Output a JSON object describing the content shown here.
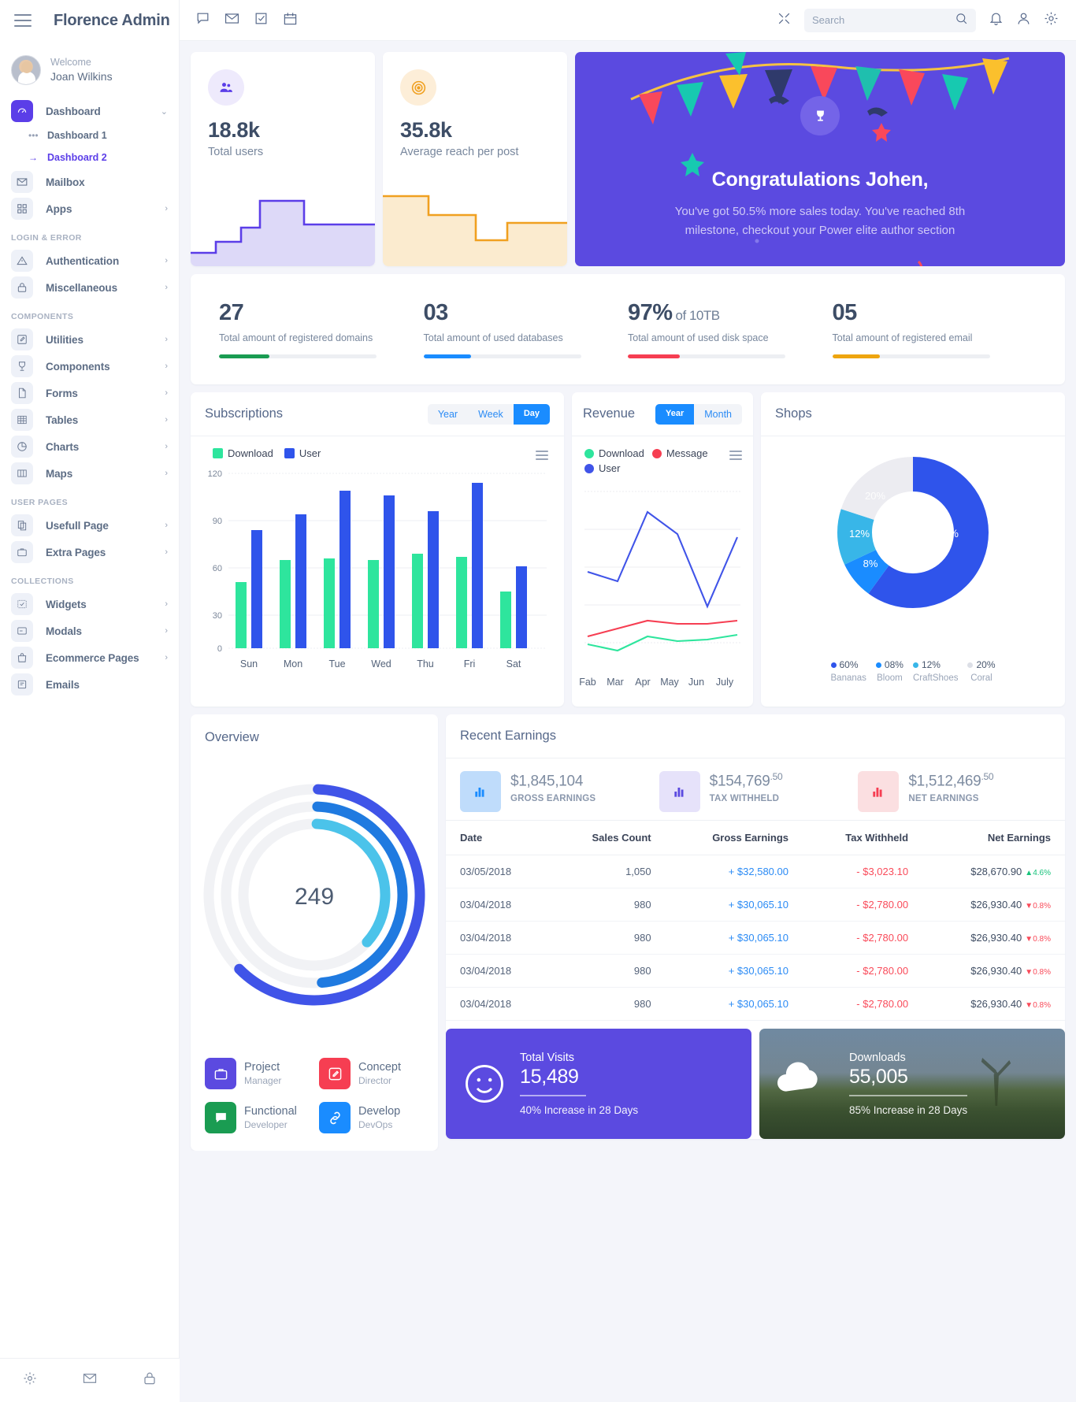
{
  "brand": {
    "name": "Florence Admin"
  },
  "user": {
    "welcome": "Welcome",
    "name": "Joan Wilkins"
  },
  "sidebar": {
    "items": [
      {
        "label": "Dashboard",
        "icon": "dashboard-icon",
        "chevron": "⌄"
      },
      {
        "label": "Mailbox",
        "icon": "mail-icon",
        "chevron": ""
      },
      {
        "label": "Apps",
        "icon": "apps-icon",
        "chevron": "›"
      }
    ],
    "sub": [
      {
        "label": "Dashboard 1",
        "marker": "•••"
      },
      {
        "label": "Dashboard 2",
        "marker": "→"
      }
    ],
    "sections": [
      {
        "title": "LOGIN & ERROR",
        "items": [
          {
            "label": "Authentication",
            "icon": "warning-icon",
            "chevron": "›"
          },
          {
            "label": "Miscellaneous",
            "icon": "lock-icon",
            "chevron": "›"
          }
        ]
      },
      {
        "title": "COMPONENTS",
        "items": [
          {
            "label": "Utilities",
            "icon": "pencil-icon",
            "chevron": "›"
          },
          {
            "label": "Components",
            "icon": "trophy-icon",
            "chevron": "›"
          },
          {
            "label": "Forms",
            "icon": "file-icon",
            "chevron": "›"
          },
          {
            "label": "Tables",
            "icon": "table-icon",
            "chevron": "›"
          },
          {
            "label": "Charts",
            "icon": "piechart-icon",
            "chevron": "›"
          },
          {
            "label": "Maps",
            "icon": "map-icon",
            "chevron": "›"
          }
        ]
      },
      {
        "title": "USER PAGES",
        "items": [
          {
            "label": "Usefull Page",
            "icon": "copy-icon",
            "chevron": "›"
          },
          {
            "label": "Extra Pages",
            "icon": "briefcase-icon",
            "chevron": "›"
          }
        ]
      },
      {
        "title": "COLLECTIONS",
        "items": [
          {
            "label": "Widgets",
            "icon": "widget-icon",
            "chevron": "›"
          },
          {
            "label": "Modals",
            "icon": "modal-icon",
            "chevron": "›"
          },
          {
            "label": "Ecommerce Pages",
            "icon": "bag-icon",
            "chevron": "›"
          },
          {
            "label": "Emails",
            "icon": "email-icon",
            "chevron": ""
          }
        ]
      }
    ]
  },
  "topbar": {
    "icons": [
      "chat-icon",
      "mail-icon",
      "task-icon",
      "calendar-icon"
    ],
    "expand_icon": "expand-icon",
    "search": {
      "placeholder": "Search",
      "value": "",
      "icon": "search-icon"
    },
    "bell_icon": "bell-icon",
    "user_icon": "user-icon",
    "gear_icon": "gear-icon"
  },
  "stat_cards": [
    {
      "value": "18.8k",
      "label": "Total users",
      "icon": "users-icon",
      "color": "#5b3ee8"
    },
    {
      "value": "35.8k",
      "label": "Average reach per post",
      "icon": "target-icon",
      "color": "#f0a020"
    }
  ],
  "welcome_card": {
    "title": "Congratulations Johen,",
    "body": "You've got 50.5% more sales today. You've reached 8th milestone, checkout your Power elite author section",
    "icon": "trophy-icon",
    "bg": "#5b4ae0"
  },
  "mini_stats": [
    {
      "value": "27",
      "suffix": "",
      "label": "Total amount of registered domains",
      "color": "#1a9c52",
      "pct": 32
    },
    {
      "value": "03",
      "suffix": "",
      "label": "Total amount of used databases",
      "color": "#1a8cff",
      "pct": 30
    },
    {
      "value": "97%",
      "suffix": "of 10TB",
      "label": "Total amount of used disk space",
      "color": "#f63e52",
      "pct": 33
    },
    {
      "value": "05",
      "suffix": "",
      "label": "Total amount of registered email",
      "color": "#eea50f",
      "pct": 30
    }
  ],
  "subscriptions": {
    "title": "Subscriptions",
    "toggle": [
      {
        "label": "Year",
        "active": false
      },
      {
        "label": "Week",
        "active": false
      },
      {
        "label": "Day",
        "active": true
      }
    ],
    "menu_icon": "menu-icon"
  },
  "revenue": {
    "title": "Revenue",
    "toggle": [
      {
        "label": "Year",
        "active": true
      },
      {
        "label": "Month",
        "active": false
      }
    ],
    "menu_icon": "menu-icon"
  },
  "shops": {
    "title": "Shops"
  },
  "overview": {
    "title": "Overview",
    "center_value": "249"
  },
  "team": [
    {
      "name": "Project",
      "role": "Manager",
      "icon": "briefcase-icon",
      "color": "#5b4ae0"
    },
    {
      "name": "Concept",
      "role": "Director",
      "icon": "edit-icon",
      "color": "#f63e52"
    },
    {
      "name": "Functional",
      "role": "Developer",
      "icon": "chat-icon",
      "color": "#1a9c52"
    },
    {
      "name": "Develop",
      "role": "DevOps",
      "icon": "link-icon",
      "color": "#1a8cff"
    }
  ],
  "earnings": {
    "title": "Recent Earnings",
    "summary": [
      {
        "amount": "$1,845,104",
        "cents": "",
        "label": "GROSS EARNINGS",
        "icon": "bars-icon",
        "bg": "#bfdcfb",
        "bar": "#1a8cff"
      },
      {
        "amount": "$154,769",
        "cents": ".50",
        "label": "TAX WITHHELD",
        "icon": "bars-icon",
        "bg": "#e6e2fa",
        "bar": "#5b4ae0"
      },
      {
        "amount": "$1,512,469",
        "cents": ".50",
        "label": "NET EARNINGS",
        "icon": "bars-icon",
        "bg": "#fbdfe1",
        "bar": "#f63e52"
      }
    ],
    "columns": [
      "Date",
      "Sales Count",
      "Gross Earnings",
      "Tax Withheld",
      "Net Earnings"
    ],
    "rows": [
      {
        "date": "03/05/2018",
        "count": "1,050",
        "gross": "+ $32,580.00",
        "tax": "- $3,023.10",
        "net": "$28,670.90",
        "pct": "4.6%",
        "dir": "up"
      },
      {
        "date": "03/04/2018",
        "count": "980",
        "gross": "+ $30,065.10",
        "tax": "- $2,780.00",
        "net": "$26,930.40",
        "pct": "0.8%",
        "dir": "down"
      },
      {
        "date": "03/04/2018",
        "count": "980",
        "gross": "+ $30,065.10",
        "tax": "- $2,780.00",
        "net": "$26,930.40",
        "pct": "0.8%",
        "dir": "down"
      },
      {
        "date": "03/04/2018",
        "count": "980",
        "gross": "+ $30,065.10",
        "tax": "- $2,780.00",
        "net": "$26,930.40",
        "pct": "0.8%",
        "dir": "down"
      },
      {
        "date": "03/04/2018",
        "count": "980",
        "gross": "+ $30,065.10",
        "tax": "- $2,780.00",
        "net": "$26,930.40",
        "pct": "0.8%",
        "dir": "down"
      }
    ]
  },
  "bottom_cards": [
    {
      "label": "Total Visits",
      "value": "15,489",
      "sub": "40% Increase in 28 Days",
      "icon": "smiley-icon"
    },
    {
      "label": "Downloads",
      "value": "55,005",
      "sub": "85% Increase in 28 Days",
      "icon": "cloud-icon"
    }
  ],
  "chart_data": [
    {
      "type": "bar",
      "title": "Subscriptions",
      "categories": [
        "Sun",
        "Mon",
        "Tue",
        "Wed",
        "Thu",
        "Fri",
        "Sat"
      ],
      "series": [
        {
          "name": "Download",
          "color": "#2ee59d",
          "values": [
            42,
            56,
            57,
            56,
            60,
            58,
            36
          ]
        },
        {
          "name": "User",
          "color": "#2f54eb",
          "values": [
            75,
            85,
            100,
            97,
            87,
            105,
            52
          ]
        }
      ],
      "ylim": [
        0,
        120
      ],
      "yticks": [
        0,
        30,
        60,
        90,
        120
      ],
      "xlabel": "",
      "ylabel": "",
      "grid": true,
      "legend": "top-left"
    },
    {
      "type": "line",
      "title": "Revenue",
      "x": [
        "Fab",
        "Mar",
        "Apr",
        "May",
        "Jun",
        "July"
      ],
      "series": [
        {
          "name": "Download",
          "color": "#2ee59d",
          "values": [
            12,
            9,
            17,
            14,
            15,
            18
          ]
        },
        {
          "name": "Message",
          "color": "#f63e52",
          "values": [
            20,
            17,
            27,
            25,
            25,
            27
          ]
        },
        {
          "name": "User",
          "color": "#4054e8",
          "values": [
            58,
            52,
            88,
            73,
            40,
            76
          ]
        }
      ],
      "ylim": [
        0,
        100
      ],
      "grid": true,
      "legend": "top-left"
    },
    {
      "type": "pie",
      "title": "Shops",
      "labels": [
        "Bananas",
        "Bloom",
        "CraftShoes",
        "Coral"
      ],
      "values": [
        60,
        8,
        12,
        20
      ],
      "display": [
        "60%",
        "08%",
        "12%",
        "20%"
      ],
      "colors": [
        "#2f54eb",
        "#1a8cff",
        "#38b6e8",
        "#ececf1"
      ],
      "donut": true
    },
    {
      "type": "pie",
      "title": "Overview",
      "labels": [
        "ring-1",
        "ring-2",
        "ring-3"
      ],
      "values": [
        62,
        48,
        36
      ],
      "colors": [
        "#4054e8",
        "#1f7ae0",
        "#4bc3ea"
      ],
      "center": "249",
      "donut": true
    }
  ]
}
